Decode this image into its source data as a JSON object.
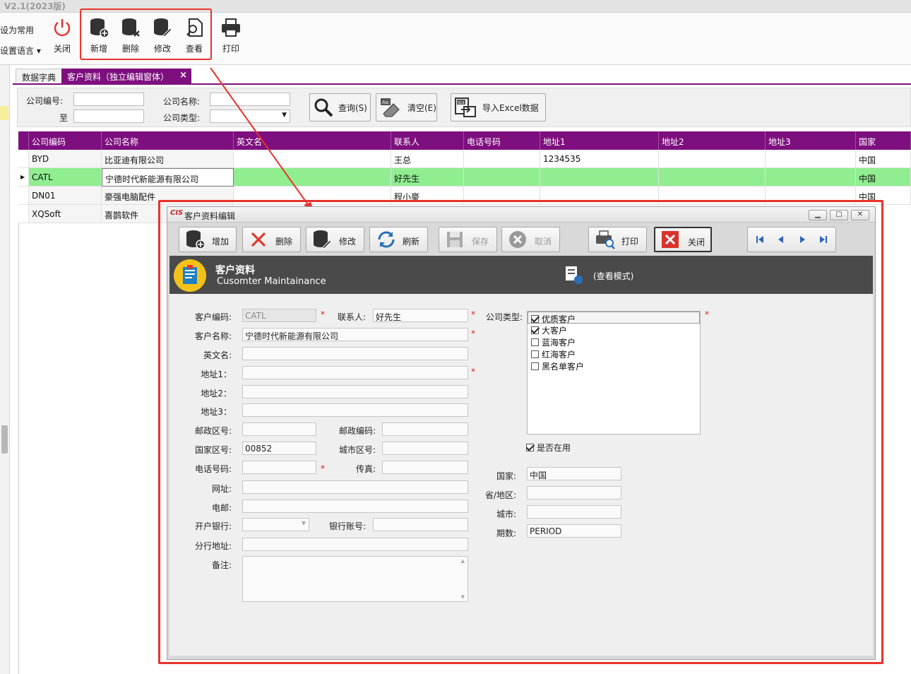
{
  "app": {
    "title": "V2.1(2023版)"
  },
  "ribbon": {
    "set_common": "设为常用",
    "set_language": "设置语言",
    "close": "关闭",
    "new": "新增",
    "delete": "删除",
    "edit": "修改",
    "view": "查看",
    "print": "打印"
  },
  "tabs": [
    {
      "label": "数据字典"
    },
    {
      "label": "客户资料（独立编辑窗体）",
      "close": "×"
    }
  ],
  "search": {
    "code_label": "公司编号:",
    "to_label": "至",
    "name_label": "公司名称:",
    "type_label": "公司类型:",
    "query_btn": "查询(S)",
    "clear_btn": "清空(E)",
    "import_btn": "导入Excel数据"
  },
  "grid": {
    "columns": [
      "公司编码",
      "公司名称",
      "英文名",
      "联系人",
      "电话号码",
      "地址1",
      "地址2",
      "地址3",
      "国家"
    ],
    "rows": [
      {
        "code": "BYD",
        "name": "比亚迪有限公司",
        "contact": "王总",
        "addr1": "1234535",
        "country": "中国"
      },
      {
        "code": "CATL",
        "name": "宁德时代新能源有限公司",
        "contact": "好先生",
        "addr1": "",
        "country": "中国"
      },
      {
        "code": "DN01",
        "name": "豪强电脑配件",
        "contact": "程小豪",
        "addr1": "",
        "country": "中国"
      },
      {
        "code": "XQSoft",
        "name": "喜鹊软件",
        "contact": "",
        "addr1": "",
        "country": ""
      }
    ]
  },
  "dialog": {
    "logo": "CIS",
    "title": "客户资料编辑",
    "toolbar": {
      "add": "增加",
      "delete": "删除",
      "edit": "修改",
      "refresh": "刷新",
      "save": "保存",
      "cancel": "取消",
      "print": "打印",
      "close": "关闭"
    },
    "header": {
      "title": "客户资料",
      "subtitle": "Cusomter Maintainance",
      "mode": "(查看模式)"
    },
    "form": {
      "cust_code_label": "客户编码:",
      "cust_code": "CATL",
      "contact_label": "联系人:",
      "contact": "好先生",
      "cust_name_label": "客户名称:",
      "cust_name": "宁德时代新能源有限公司",
      "en_name_label": "英文名:",
      "addr1_label": "地址1：",
      "addr2_label": "地址2：",
      "addr3_label": "地址3：",
      "post_area_label": "邮政区号:",
      "post_code_label": "邮政编码:",
      "country_code_label": "国家区号:",
      "country_code": "00852",
      "city_code_label": "城市区号:",
      "phone_label": "电话号码:",
      "fax_label": "传真:",
      "website_label": "网址:",
      "email_label": "电邮:",
      "bank_label": "开户银行:",
      "bank_account_label": "银行账号:",
      "branch_addr_label": "分行地址:",
      "remark_label": "备注:",
      "company_type_label": "公司类型:",
      "company_types": [
        {
          "label": "优质客户",
          "checked": true
        },
        {
          "label": "大客户",
          "checked": true
        },
        {
          "label": "蓝海客户",
          "checked": false
        },
        {
          "label": "红海客户",
          "checked": false
        },
        {
          "label": "黑名单客户",
          "checked": false
        }
      ],
      "in_use_label": "是否在用",
      "country_label": "国家:",
      "country": "中国",
      "province_label": "省/地区:",
      "city_label": "城市:",
      "period_label": "期数:",
      "period": "PERIOD",
      "required_mark": "*"
    }
  },
  "colors": {
    "accent": "#7e0f7e",
    "highlight": "#90ee90",
    "annotation": "#e8322c"
  }
}
